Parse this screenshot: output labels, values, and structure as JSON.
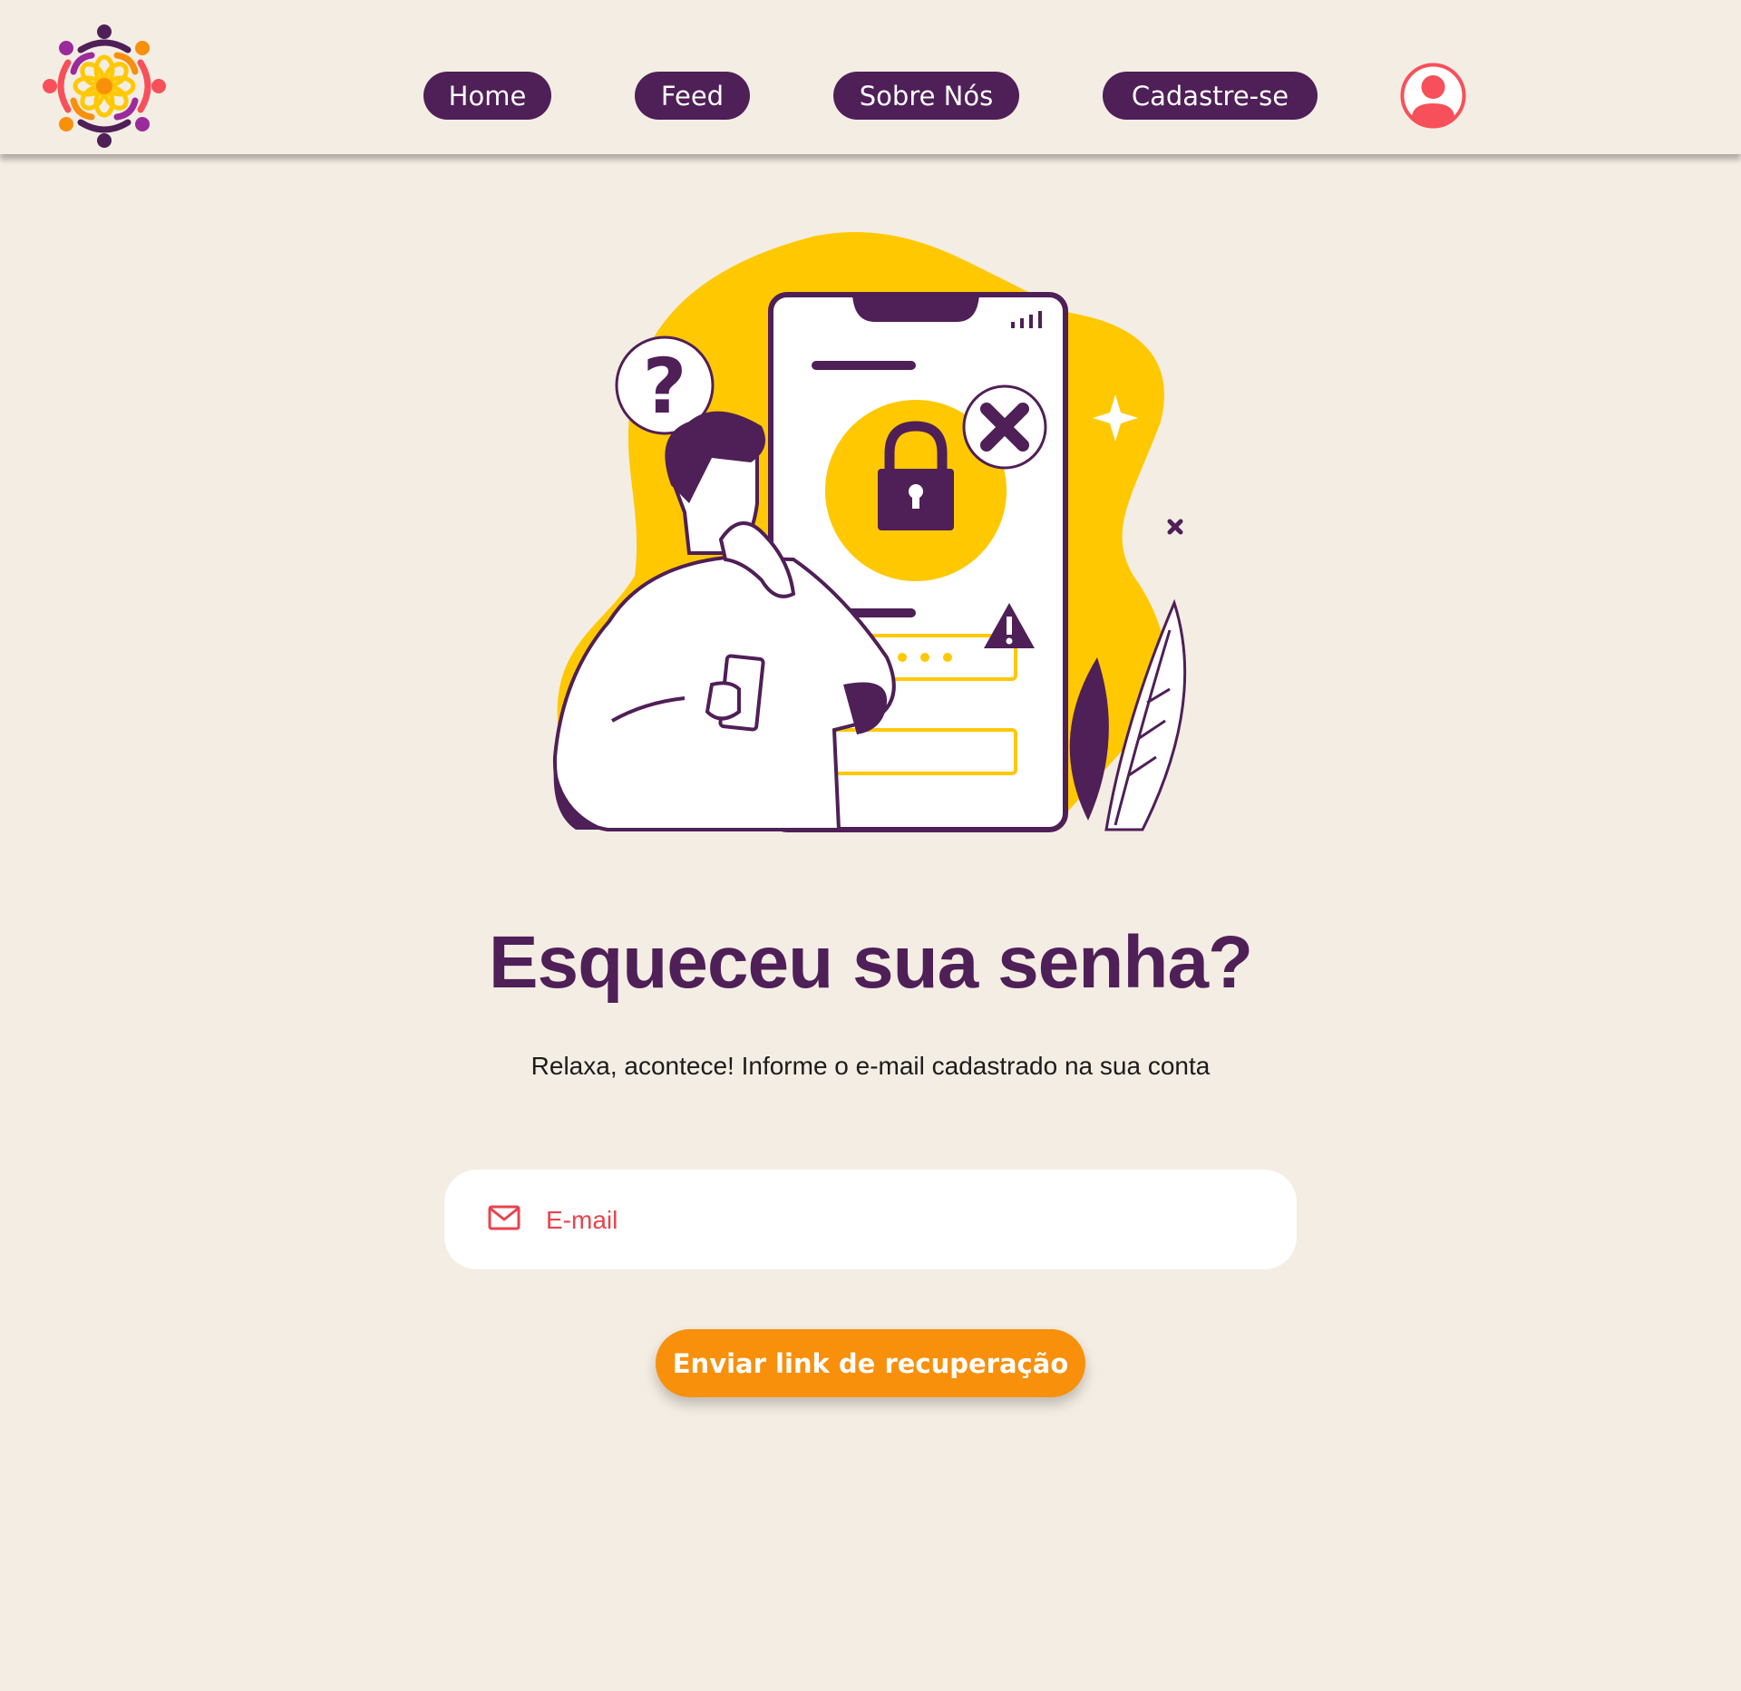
{
  "nav": {
    "home": "Home",
    "feed": "Feed",
    "about": "Sobre Nós",
    "signup": "Cadastre-se"
  },
  "icons": {
    "logo": "community-flower-logo",
    "avatar": "user-profile-icon",
    "mail": "mail-icon",
    "illustration": "forgot-password-illustration"
  },
  "main": {
    "title": "Esqueceu sua senha?",
    "subtitle": "Relaxa, acontece! Informe o e-mail cadastrado na sua conta",
    "email_placeholder": "E-mail",
    "email_value": "",
    "submit_label": "Enviar link de recuperação"
  },
  "colors": {
    "background": "#f4ede3",
    "brand_purple": "#4f1f57",
    "accent_orange": "#f8900c",
    "accent_red": "#e9434e",
    "accent_yellow": "#ffc800"
  }
}
